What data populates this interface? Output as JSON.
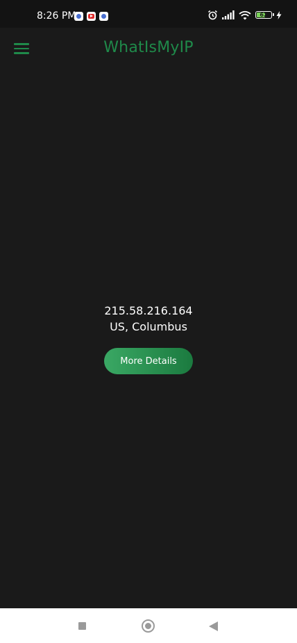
{
  "status_bar": {
    "time": "8:26 PM",
    "notification_icons": [
      "app-icon",
      "youtube-icon",
      "app-icon"
    ],
    "system_icons": [
      "alarm-icon",
      "signal-icon",
      "wifi-icon",
      "battery-icon",
      "charging-icon"
    ],
    "battery_level": "62",
    "battery_fraction": 0.62
  },
  "app_bar": {
    "title": "WhatIsMyIP",
    "menu_icon": "hamburger-menu-icon"
  },
  "ip_info": {
    "ip_address": "215.58.216.164",
    "location": "US, Columbus"
  },
  "actions": {
    "more_details_label": "More Details"
  },
  "nav_bar": {
    "icons": [
      "recent-apps-icon",
      "home-icon",
      "back-icon"
    ]
  },
  "colors": {
    "accent": "#1f8a4a",
    "button_gradient_start": "#3aa864",
    "button_gradient_end": "#1b7a3f",
    "background": "#1a1a1a",
    "status_bar_bg": "#131313",
    "battery_fill": "#7cd35a"
  }
}
